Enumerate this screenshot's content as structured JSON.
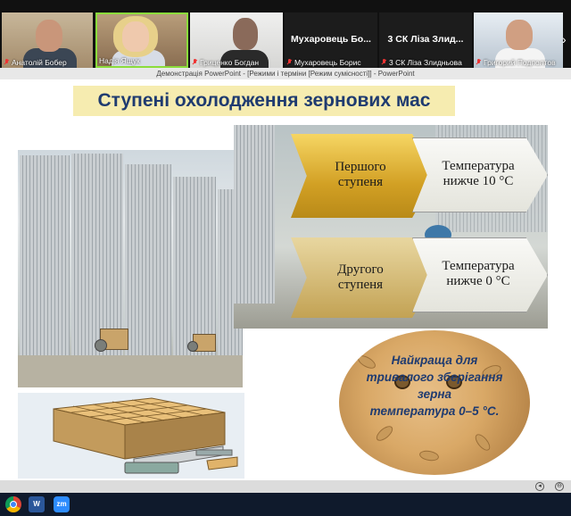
{
  "participants": [
    {
      "name": "Анатолій Бобер",
      "muted": true,
      "video": true
    },
    {
      "name": "Надія Ящук",
      "muted": false,
      "video": true
    },
    {
      "name": "Гриценко Богдан",
      "muted": true,
      "video": true
    },
    {
      "name": "Мухаровець Борис",
      "muted": true,
      "video": false,
      "display_name": "Мухаровець  Бо..."
    },
    {
      "name": "3 СК Ліза Злидньова",
      "muted": true,
      "video": false,
      "display_name": "3 СК Ліза Злид..."
    },
    {
      "name": "Григорий Подполтов",
      "muted": true,
      "video": true
    }
  ],
  "presentation_window_title": "Демонстрація PowerPoint - [Режими і терміни [Режим сумісності]] - PowerPoint",
  "slide": {
    "title": "Ступені охолодження зернових мас",
    "stages": [
      {
        "label": "Першого ступеня",
        "temperature": "Температура нижче 10 °С"
      },
      {
        "label": "Другого ступеня",
        "temperature": "Температура нижче 0 °С"
      }
    ],
    "best_storage": {
      "line1": "Найкраща для",
      "line2": "тривалого зберігання",
      "line3": "зерна",
      "line4": "температура 0–5 °С."
    }
  },
  "taskbar": {
    "icons": [
      "chrome-icon",
      "word-icon",
      "zoom-icon"
    ],
    "word_label": "W",
    "zoom_label": "zm"
  },
  "colors": {
    "title_bg": "#f6ecb0",
    "title_text": "#1f3b70",
    "chevron_gold": "#d2a024",
    "muted_red": "#e33"
  }
}
